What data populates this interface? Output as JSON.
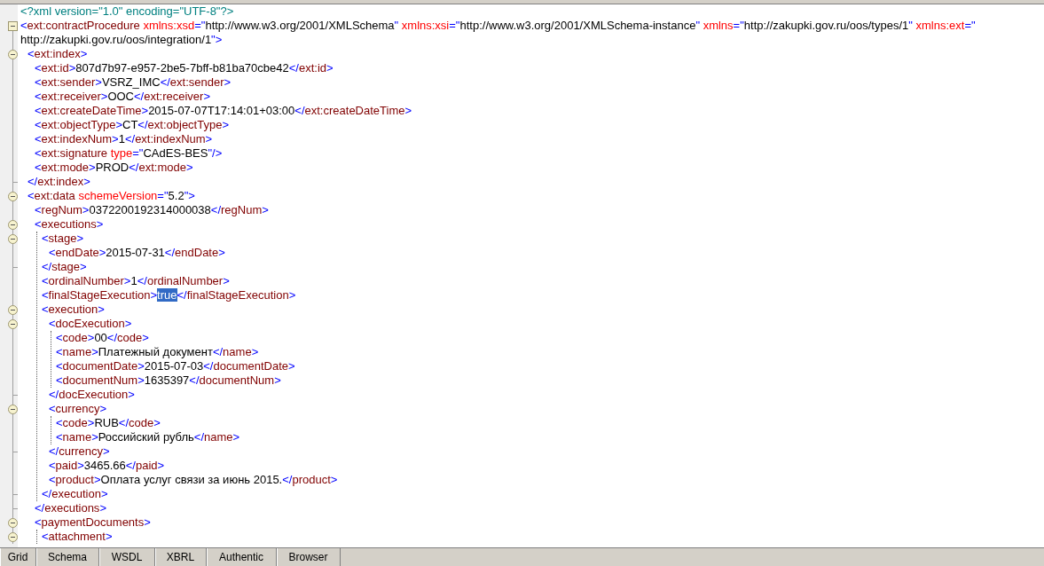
{
  "document": [
    {
      "line": [
        {
          "kind": "pi",
          "text": "<?xml version=\"1.0\" encoding=\"UTF-8\"?>"
        }
      ]
    },
    {
      "expanded": true,
      "guide_line": false,
      "start": [
        [
          {
            "kind": "punct",
            "text": "<"
          },
          {
            "kind": "name",
            "text": "ext:contractProcedure"
          },
          {
            "kind": "attr",
            "text": " xmlns:xsd"
          },
          {
            "kind": "punct",
            "text": "=\""
          },
          {
            "kind": "value",
            "text": "http://www.w3.org/2001/XMLSchema"
          },
          {
            "kind": "punct",
            "text": "\""
          },
          {
            "kind": "attr",
            "text": " xmlns:xsi"
          },
          {
            "kind": "punct",
            "text": "=\""
          },
          {
            "kind": "value",
            "text": "http://www.w3.org/2001/XMLSchema-instance"
          },
          {
            "kind": "punct",
            "text": "\""
          },
          {
            "kind": "attr",
            "text": " xmlns"
          },
          {
            "kind": "punct",
            "text": "=\""
          },
          {
            "kind": "value",
            "text": "http://zakupki.gov.ru/oos/types/1"
          },
          {
            "kind": "punct",
            "text": "\""
          },
          {
            "kind": "attr",
            "text": " xmlns:ext"
          },
          {
            "kind": "punct",
            "text": "=\""
          }
        ],
        [
          {
            "kind": "value",
            "text": "http://zakupki.gov.ru/oos/integration/1"
          },
          {
            "kind": "punct",
            "text": "\">"
          }
        ]
      ],
      "children": [
        {
          "expanded": true,
          "guide_line": false,
          "start": [
            [
              {
                "kind": "punct",
                "text": "<"
              },
              {
                "kind": "name",
                "text": "ext:index"
              },
              {
                "kind": "punct",
                "text": ">"
              }
            ]
          ],
          "children": [
            {
              "line": [
                {
                  "kind": "punct",
                  "text": "<"
                },
                {
                  "kind": "name",
                  "text": "ext:id"
                },
                {
                  "kind": "punct",
                  "text": ">"
                },
                {
                  "kind": "text",
                  "text": "807d7b97-e957-2be5-7bff-b81ba70cbe42"
                },
                {
                  "kind": "punct",
                  "text": "</"
                },
                {
                  "kind": "name",
                  "text": "ext:id"
                },
                {
                  "kind": "punct",
                  "text": ">"
                }
              ]
            },
            {
              "line": [
                {
                  "kind": "punct",
                  "text": "<"
                },
                {
                  "kind": "name",
                  "text": "ext:sender"
                },
                {
                  "kind": "punct",
                  "text": ">"
                },
                {
                  "kind": "text",
                  "text": "VSRZ_IMC"
                },
                {
                  "kind": "punct",
                  "text": "</"
                },
                {
                  "kind": "name",
                  "text": "ext:sender"
                },
                {
                  "kind": "punct",
                  "text": ">"
                }
              ]
            },
            {
              "line": [
                {
                  "kind": "punct",
                  "text": "<"
                },
                {
                  "kind": "name",
                  "text": "ext:receiver"
                },
                {
                  "kind": "punct",
                  "text": ">"
                },
                {
                  "kind": "text",
                  "text": "OOC"
                },
                {
                  "kind": "punct",
                  "text": "</"
                },
                {
                  "kind": "name",
                  "text": "ext:receiver"
                },
                {
                  "kind": "punct",
                  "text": ">"
                }
              ]
            },
            {
              "line": [
                {
                  "kind": "punct",
                  "text": "<"
                },
                {
                  "kind": "name",
                  "text": "ext:createDateTime"
                },
                {
                  "kind": "punct",
                  "text": ">"
                },
                {
                  "kind": "text",
                  "text": "2015-07-07T17:14:01+03:00"
                },
                {
                  "kind": "punct",
                  "text": "</"
                },
                {
                  "kind": "name",
                  "text": "ext:createDateTime"
                },
                {
                  "kind": "punct",
                  "text": ">"
                }
              ]
            },
            {
              "line": [
                {
                  "kind": "punct",
                  "text": "<"
                },
                {
                  "kind": "name",
                  "text": "ext:objectType"
                },
                {
                  "kind": "punct",
                  "text": ">"
                },
                {
                  "kind": "text",
                  "text": "CT"
                },
                {
                  "kind": "punct",
                  "text": "</"
                },
                {
                  "kind": "name",
                  "text": "ext:objectType"
                },
                {
                  "kind": "punct",
                  "text": ">"
                }
              ]
            },
            {
              "line": [
                {
                  "kind": "punct",
                  "text": "<"
                },
                {
                  "kind": "name",
                  "text": "ext:indexNum"
                },
                {
                  "kind": "punct",
                  "text": ">"
                },
                {
                  "kind": "text",
                  "text": "1"
                },
                {
                  "kind": "punct",
                  "text": "</"
                },
                {
                  "kind": "name",
                  "text": "ext:indexNum"
                },
                {
                  "kind": "punct",
                  "text": ">"
                }
              ]
            },
            {
              "line": [
                {
                  "kind": "punct",
                  "text": "<"
                },
                {
                  "kind": "name",
                  "text": "ext:signature"
                },
                {
                  "kind": "attr",
                  "text": " type"
                },
                {
                  "kind": "punct",
                  "text": "=\""
                },
                {
                  "kind": "value",
                  "text": "CAdES-BES"
                },
                {
                  "kind": "punct",
                  "text": "\"/>"
                }
              ]
            },
            {
              "line": [
                {
                  "kind": "punct",
                  "text": "<"
                },
                {
                  "kind": "name",
                  "text": "ext:mode"
                },
                {
                  "kind": "punct",
                  "text": ">"
                },
                {
                  "kind": "text",
                  "text": "PROD"
                },
                {
                  "kind": "punct",
                  "text": "</"
                },
                {
                  "kind": "name",
                  "text": "ext:mode"
                },
                {
                  "kind": "punct",
                  "text": ">"
                }
              ]
            }
          ],
          "end": [
            {
              "kind": "punct",
              "text": "</"
            },
            {
              "kind": "name",
              "text": "ext:index"
            },
            {
              "kind": "punct",
              "text": ">"
            }
          ]
        },
        {
          "expanded": true,
          "guide_line": false,
          "start": [
            [
              {
                "kind": "punct",
                "text": "<"
              },
              {
                "kind": "name",
                "text": "ext:data"
              },
              {
                "kind": "attr",
                "text": " schemeVersion"
              },
              {
                "kind": "punct",
                "text": "=\""
              },
              {
                "kind": "value",
                "text": "5.2"
              },
              {
                "kind": "punct",
                "text": "\">"
              }
            ]
          ],
          "children": [
            {
              "line": [
                {
                  "kind": "punct",
                  "text": "<"
                },
                {
                  "kind": "name",
                  "text": "regNum"
                },
                {
                  "kind": "punct",
                  "text": ">"
                },
                {
                  "kind": "text",
                  "text": "0372200192314000038"
                },
                {
                  "kind": "punct",
                  "text": "</"
                },
                {
                  "kind": "name",
                  "text": "regNum"
                },
                {
                  "kind": "punct",
                  "text": ">"
                }
              ]
            },
            {
              "expanded": true,
              "guide_line": true,
              "start": [
                [
                  {
                    "kind": "punct",
                    "text": "<"
                  },
                  {
                    "kind": "name",
                    "text": "executions"
                  },
                  {
                    "kind": "punct",
                    "text": ">"
                  }
                ]
              ],
              "children": [
                {
                  "expanded": true,
                  "guide_line": false,
                  "start": [
                    [
                      {
                        "kind": "punct",
                        "text": "<"
                      },
                      {
                        "kind": "name",
                        "text": "stage"
                      },
                      {
                        "kind": "punct",
                        "text": ">"
                      }
                    ]
                  ],
                  "children": [
                    {
                      "line": [
                        {
                          "kind": "punct",
                          "text": "<"
                        },
                        {
                          "kind": "name",
                          "text": "endDate"
                        },
                        {
                          "kind": "punct",
                          "text": ">"
                        },
                        {
                          "kind": "text",
                          "text": "2015-07-31"
                        },
                        {
                          "kind": "punct",
                          "text": "</"
                        },
                        {
                          "kind": "name",
                          "text": "endDate"
                        },
                        {
                          "kind": "punct",
                          "text": ">"
                        }
                      ]
                    }
                  ],
                  "end": [
                    {
                      "kind": "punct",
                      "text": "</"
                    },
                    {
                      "kind": "name",
                      "text": "stage"
                    },
                    {
                      "kind": "punct",
                      "text": ">"
                    }
                  ]
                },
                {
                  "line": [
                    {
                      "kind": "punct",
                      "text": "<"
                    },
                    {
                      "kind": "name",
                      "text": "ordinalNumber"
                    },
                    {
                      "kind": "punct",
                      "text": ">"
                    },
                    {
                      "kind": "text",
                      "text": "1"
                    },
                    {
                      "kind": "punct",
                      "text": "</"
                    },
                    {
                      "kind": "name",
                      "text": "ordinalNumber"
                    },
                    {
                      "kind": "punct",
                      "text": ">"
                    }
                  ]
                },
                {
                  "line": [
                    {
                      "kind": "punct",
                      "text": "<"
                    },
                    {
                      "kind": "name",
                      "text": "finalStageExecution"
                    },
                    {
                      "kind": "punct",
                      "text": ">"
                    },
                    {
                      "kind": "selected",
                      "text": "true"
                    },
                    {
                      "kind": "punct",
                      "text": "</"
                    },
                    {
                      "kind": "name",
                      "text": "finalStageExecution"
                    },
                    {
                      "kind": "punct",
                      "text": ">"
                    }
                  ]
                },
                {
                  "expanded": true,
                  "guide_line": false,
                  "start": [
                    [
                      {
                        "kind": "punct",
                        "text": "<"
                      },
                      {
                        "kind": "name",
                        "text": "execution"
                      },
                      {
                        "kind": "punct",
                        "text": ">"
                      }
                    ]
                  ],
                  "children": [
                    {
                      "expanded": true,
                      "guide_line": true,
                      "start": [
                        [
                          {
                            "kind": "punct",
                            "text": "<"
                          },
                          {
                            "kind": "name",
                            "text": "docExecution"
                          },
                          {
                            "kind": "punct",
                            "text": ">"
                          }
                        ]
                      ],
                      "children": [
                        {
                          "line": [
                            {
                              "kind": "punct",
                              "text": "<"
                            },
                            {
                              "kind": "name",
                              "text": "code"
                            },
                            {
                              "kind": "punct",
                              "text": ">"
                            },
                            {
                              "kind": "text",
                              "text": "00"
                            },
                            {
                              "kind": "punct",
                              "text": "</"
                            },
                            {
                              "kind": "name",
                              "text": "code"
                            },
                            {
                              "kind": "punct",
                              "text": ">"
                            }
                          ]
                        },
                        {
                          "line": [
                            {
                              "kind": "punct",
                              "text": "<"
                            },
                            {
                              "kind": "name",
                              "text": "name"
                            },
                            {
                              "kind": "punct",
                              "text": ">"
                            },
                            {
                              "kind": "text",
                              "text": "Платежный документ"
                            },
                            {
                              "kind": "punct",
                              "text": "</"
                            },
                            {
                              "kind": "name",
                              "text": "name"
                            },
                            {
                              "kind": "punct",
                              "text": ">"
                            }
                          ]
                        },
                        {
                          "line": [
                            {
                              "kind": "punct",
                              "text": "<"
                            },
                            {
                              "kind": "name",
                              "text": "documentDate"
                            },
                            {
                              "kind": "punct",
                              "text": ">"
                            },
                            {
                              "kind": "text",
                              "text": "2015-07-03"
                            },
                            {
                              "kind": "punct",
                              "text": "</"
                            },
                            {
                              "kind": "name",
                              "text": "documentDate"
                            },
                            {
                              "kind": "punct",
                              "text": ">"
                            }
                          ]
                        },
                        {
                          "line": [
                            {
                              "kind": "punct",
                              "text": "<"
                            },
                            {
                              "kind": "name",
                              "text": "documentNum"
                            },
                            {
                              "kind": "punct",
                              "text": ">"
                            },
                            {
                              "kind": "text",
                              "text": "1635397"
                            },
                            {
                              "kind": "punct",
                              "text": "</"
                            },
                            {
                              "kind": "name",
                              "text": "documentNum"
                            },
                            {
                              "kind": "punct",
                              "text": ">"
                            }
                          ]
                        }
                      ],
                      "end": [
                        {
                          "kind": "punct",
                          "text": "</"
                        },
                        {
                          "kind": "name",
                          "text": "docExecution"
                        },
                        {
                          "kind": "punct",
                          "text": ">"
                        }
                      ]
                    },
                    {
                      "expanded": true,
                      "guide_line": true,
                      "start": [
                        [
                          {
                            "kind": "punct",
                            "text": "<"
                          },
                          {
                            "kind": "name",
                            "text": "currency"
                          },
                          {
                            "kind": "punct",
                            "text": ">"
                          }
                        ]
                      ],
                      "children": [
                        {
                          "line": [
                            {
                              "kind": "punct",
                              "text": "<"
                            },
                            {
                              "kind": "name",
                              "text": "code"
                            },
                            {
                              "kind": "punct",
                              "text": ">"
                            },
                            {
                              "kind": "text",
                              "text": "RUB"
                            },
                            {
                              "kind": "punct",
                              "text": "</"
                            },
                            {
                              "kind": "name",
                              "text": "code"
                            },
                            {
                              "kind": "punct",
                              "text": ">"
                            }
                          ]
                        },
                        {
                          "line": [
                            {
                              "kind": "punct",
                              "text": "<"
                            },
                            {
                              "kind": "name",
                              "text": "name"
                            },
                            {
                              "kind": "punct",
                              "text": ">"
                            },
                            {
                              "kind": "text",
                              "text": "Российский рубль"
                            },
                            {
                              "kind": "punct",
                              "text": "</"
                            },
                            {
                              "kind": "name",
                              "text": "name"
                            },
                            {
                              "kind": "punct",
                              "text": ">"
                            }
                          ]
                        }
                      ],
                      "end": [
                        {
                          "kind": "punct",
                          "text": "</"
                        },
                        {
                          "kind": "name",
                          "text": "currency"
                        },
                        {
                          "kind": "punct",
                          "text": ">"
                        }
                      ]
                    },
                    {
                      "line": [
                        {
                          "kind": "punct",
                          "text": "<"
                        },
                        {
                          "kind": "name",
                          "text": "paid"
                        },
                        {
                          "kind": "punct",
                          "text": ">"
                        },
                        {
                          "kind": "text",
                          "text": "3465.66"
                        },
                        {
                          "kind": "punct",
                          "text": "</"
                        },
                        {
                          "kind": "name",
                          "text": "paid"
                        },
                        {
                          "kind": "punct",
                          "text": ">"
                        }
                      ]
                    },
                    {
                      "line": [
                        {
                          "kind": "punct",
                          "text": "<"
                        },
                        {
                          "kind": "name",
                          "text": "product"
                        },
                        {
                          "kind": "punct",
                          "text": ">"
                        },
                        {
                          "kind": "text",
                          "text": "Оплата услуг связи за июнь 2015."
                        },
                        {
                          "kind": "punct",
                          "text": "</"
                        },
                        {
                          "kind": "name",
                          "text": "product"
                        },
                        {
                          "kind": "punct",
                          "text": ">"
                        }
                      ]
                    }
                  ],
                  "end": [
                    {
                      "kind": "punct",
                      "text": "</"
                    },
                    {
                      "kind": "name",
                      "text": "execution"
                    },
                    {
                      "kind": "punct",
                      "text": ">"
                    }
                  ]
                }
              ],
              "end": [
                {
                  "kind": "punct",
                  "text": "</"
                },
                {
                  "kind": "name",
                  "text": "executions"
                },
                {
                  "kind": "punct",
                  "text": ">"
                }
              ]
            },
            {
              "expanded": true,
              "guide_line": true,
              "start": [
                [
                  {
                    "kind": "punct",
                    "text": "<"
                  },
                  {
                    "kind": "name",
                    "text": "paymentDocuments"
                  },
                  {
                    "kind": "punct",
                    "text": ">"
                  }
                ]
              ],
              "children": [
                {
                  "expanded": true,
                  "guide_line": false,
                  "start": [
                    [
                      {
                        "kind": "punct",
                        "text": "<"
                      },
                      {
                        "kind": "name",
                        "text": "attachment"
                      },
                      {
                        "kind": "punct",
                        "text": ">"
                      }
                    ]
                  ]
                }
              ]
            }
          ]
        }
      ]
    }
  ],
  "tabs": [
    {
      "label": "Grid",
      "selected": false
    },
    {
      "label": "Schema",
      "selected": false
    },
    {
      "label": "WSDL",
      "selected": false
    },
    {
      "label": "XBRL",
      "selected": false
    },
    {
      "label": "Authentic",
      "selected": false
    },
    {
      "label": "Browser",
      "selected": false
    }
  ]
}
